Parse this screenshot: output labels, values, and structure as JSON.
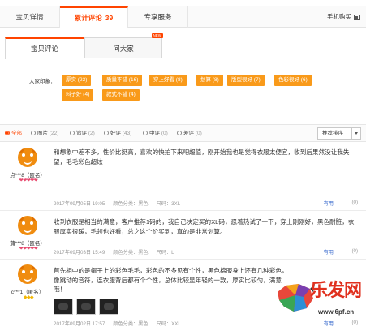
{
  "top_tabs": {
    "details": "宝贝详情",
    "reviews": "累计评论",
    "reviews_count": "39",
    "service": "专享服务",
    "phone_buy": "手机购买"
  },
  "sub_tabs": {
    "reviews": "宝贝评论",
    "ask": "问大家",
    "ask_badge": "NEW"
  },
  "impression": {
    "label": "大家印象：",
    "tags": [
      "厚实 (23)",
      "质量不错 (16)",
      "穿上好看 (8)",
      "划算 (8)",
      "版型很好 (7)",
      "色彩很好 (6)",
      "料子好 (4)",
      "款式不错 (4)"
    ]
  },
  "filters": {
    "items": [
      {
        "label": "全部",
        "count": ""
      },
      {
        "label": "图片",
        "count": "(22)"
      },
      {
        "label": "追评",
        "count": "(2)"
      },
      {
        "label": "好评",
        "count": "(43)"
      },
      {
        "label": "中评",
        "count": "(0)"
      },
      {
        "label": "差评",
        "count": "(0)"
      }
    ],
    "sort": "推荐排序"
  },
  "reviews": [
    {
      "user": "点***8（匿名）",
      "rank": "❤❤❤❤❤",
      "content": "和想象中差不多，性价比挺高，喜欢的快拍下来吧超值，刚开始我也是觉得衣服太便宜，收到后果然没让我失望，毛毛彩色超炫",
      "date": "2017年09月05日 19:05",
      "color": "颜色分类：黑色",
      "size": "尺码：3XL",
      "helpful": "有用",
      "reply": "(0)"
    },
    {
      "user": "蒲***8（匿名）",
      "rank": "❤❤❤❤❤",
      "content": "收到衣服是相当的满意，客户推荐1码的，我自己决定买的XL码，忍着热试了一下，穿上刚刚好，黑色耐脏，衣服厚实很暖，毛领也好看，总之这个价买到，真的是非常划算。",
      "date": "2017年09月03日 15:49",
      "color": "颜色分类：黑色",
      "size": "尺码：L",
      "helpful": "有用",
      "reply": "(0)"
    },
    {
      "user": "c***1（匿名）",
      "rank": "◆◆◆",
      "content": "首先相中的是帽子上的彩色毛毛，彩色的不多见有个性，黑色棉服身上还有几种彩色，像跳动的音符，连衣服背后都有个个性，总体比较显年轻的一款，厚实比较匀，满意哦！",
      "date": "2017年09月02日 17:57",
      "color": "颜色分类：黑色",
      "size": "尺码：XXL",
      "helpful": "有用",
      "reply": "(0)"
    }
  ],
  "watermark": {
    "text": "乐发网",
    "url": "www.6pf.cn"
  }
}
